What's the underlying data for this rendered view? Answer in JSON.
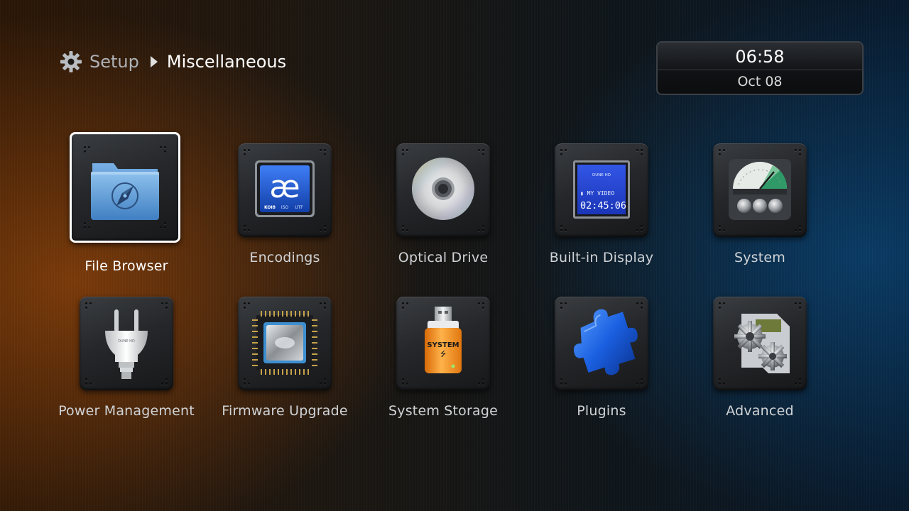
{
  "breadcrumb": {
    "icon": "gear-icon",
    "root": "Setup",
    "separator_icon": "triangle-right-icon",
    "current": "Miscellaneous"
  },
  "clock": {
    "time": "06:58",
    "date": "Oct 08"
  },
  "menu": {
    "selected_index": 0,
    "items": [
      {
        "label": "File Browser",
        "icon": "folder-compass-icon"
      },
      {
        "label": "Encodings",
        "icon": "encoding-ae-icon",
        "icon_text": "æ",
        "icon_subtext": [
          "KOI8",
          "ISO",
          "UTF"
        ]
      },
      {
        "label": "Optical Drive",
        "icon": "optical-disc-icon"
      },
      {
        "label": "Built-in Display",
        "icon": "lcd-display-icon",
        "icon_brand": "DUNE HD",
        "icon_line1": "▮ MY VIDEO",
        "icon_line2": "02:45:06"
      },
      {
        "label": "System",
        "icon": "gauge-meter-icon"
      },
      {
        "label": "Power Management",
        "icon": "power-plug-icon",
        "icon_brand": "DUNE HD"
      },
      {
        "label": "Firmware Upgrade",
        "icon": "cpu-chip-icon"
      },
      {
        "label": "System Storage",
        "icon": "usb-drive-icon",
        "icon_text": "SYSTEM"
      },
      {
        "label": "Plugins",
        "icon": "puzzle-piece-icon"
      },
      {
        "label": "Advanced",
        "icon": "gears-icon"
      }
    ]
  },
  "colors": {
    "selection_border": "#ffffff",
    "label_text": "#d0d3d6",
    "puzzle_blue": "#1a5fe0",
    "usb_orange": "#f08a1a",
    "lcd_blue": "#1c3fd0"
  }
}
